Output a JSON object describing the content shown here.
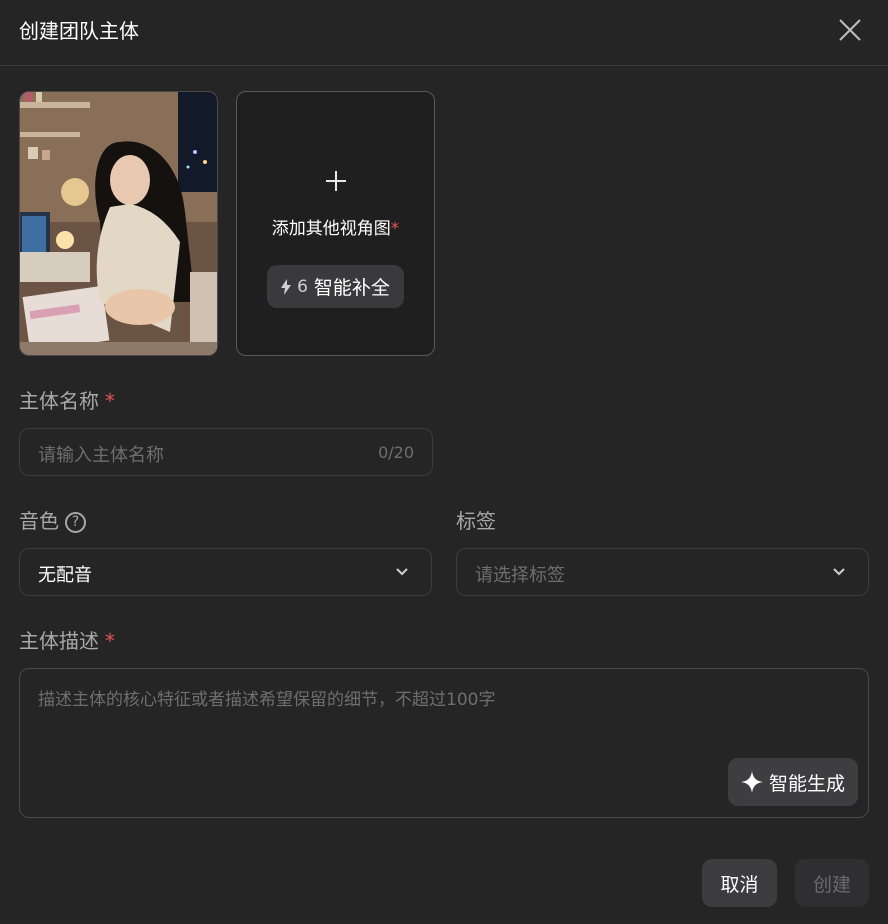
{
  "dialog": {
    "title": "创建团队主体",
    "close_icon": "close-icon"
  },
  "images": {
    "add_view_label": "添加其他视角图",
    "required_mark": "*",
    "smart_fill_count": "6",
    "smart_fill_label": "智能补全"
  },
  "name_field": {
    "label": "主体名称",
    "required_mark": "*",
    "placeholder": "请输入主体名称",
    "value": "",
    "counter": "0/20"
  },
  "voice_field": {
    "label": "音色",
    "help_glyph": "?",
    "selected": "无配音"
  },
  "tags_field": {
    "label": "标签",
    "placeholder": "请选择标签"
  },
  "description_field": {
    "label": "主体描述",
    "required_mark": "*",
    "placeholder": "描述主体的核心特征或者描述希望保留的细节，不超过100字",
    "smart_generate_label": "智能生成"
  },
  "actions": {
    "cancel_label": "取消",
    "create_label": "创建"
  },
  "colors": {
    "background": "#252526",
    "required": "#e0564f",
    "button_bg": "#3c3c3e",
    "disabled_text": "#6a6a6a"
  }
}
